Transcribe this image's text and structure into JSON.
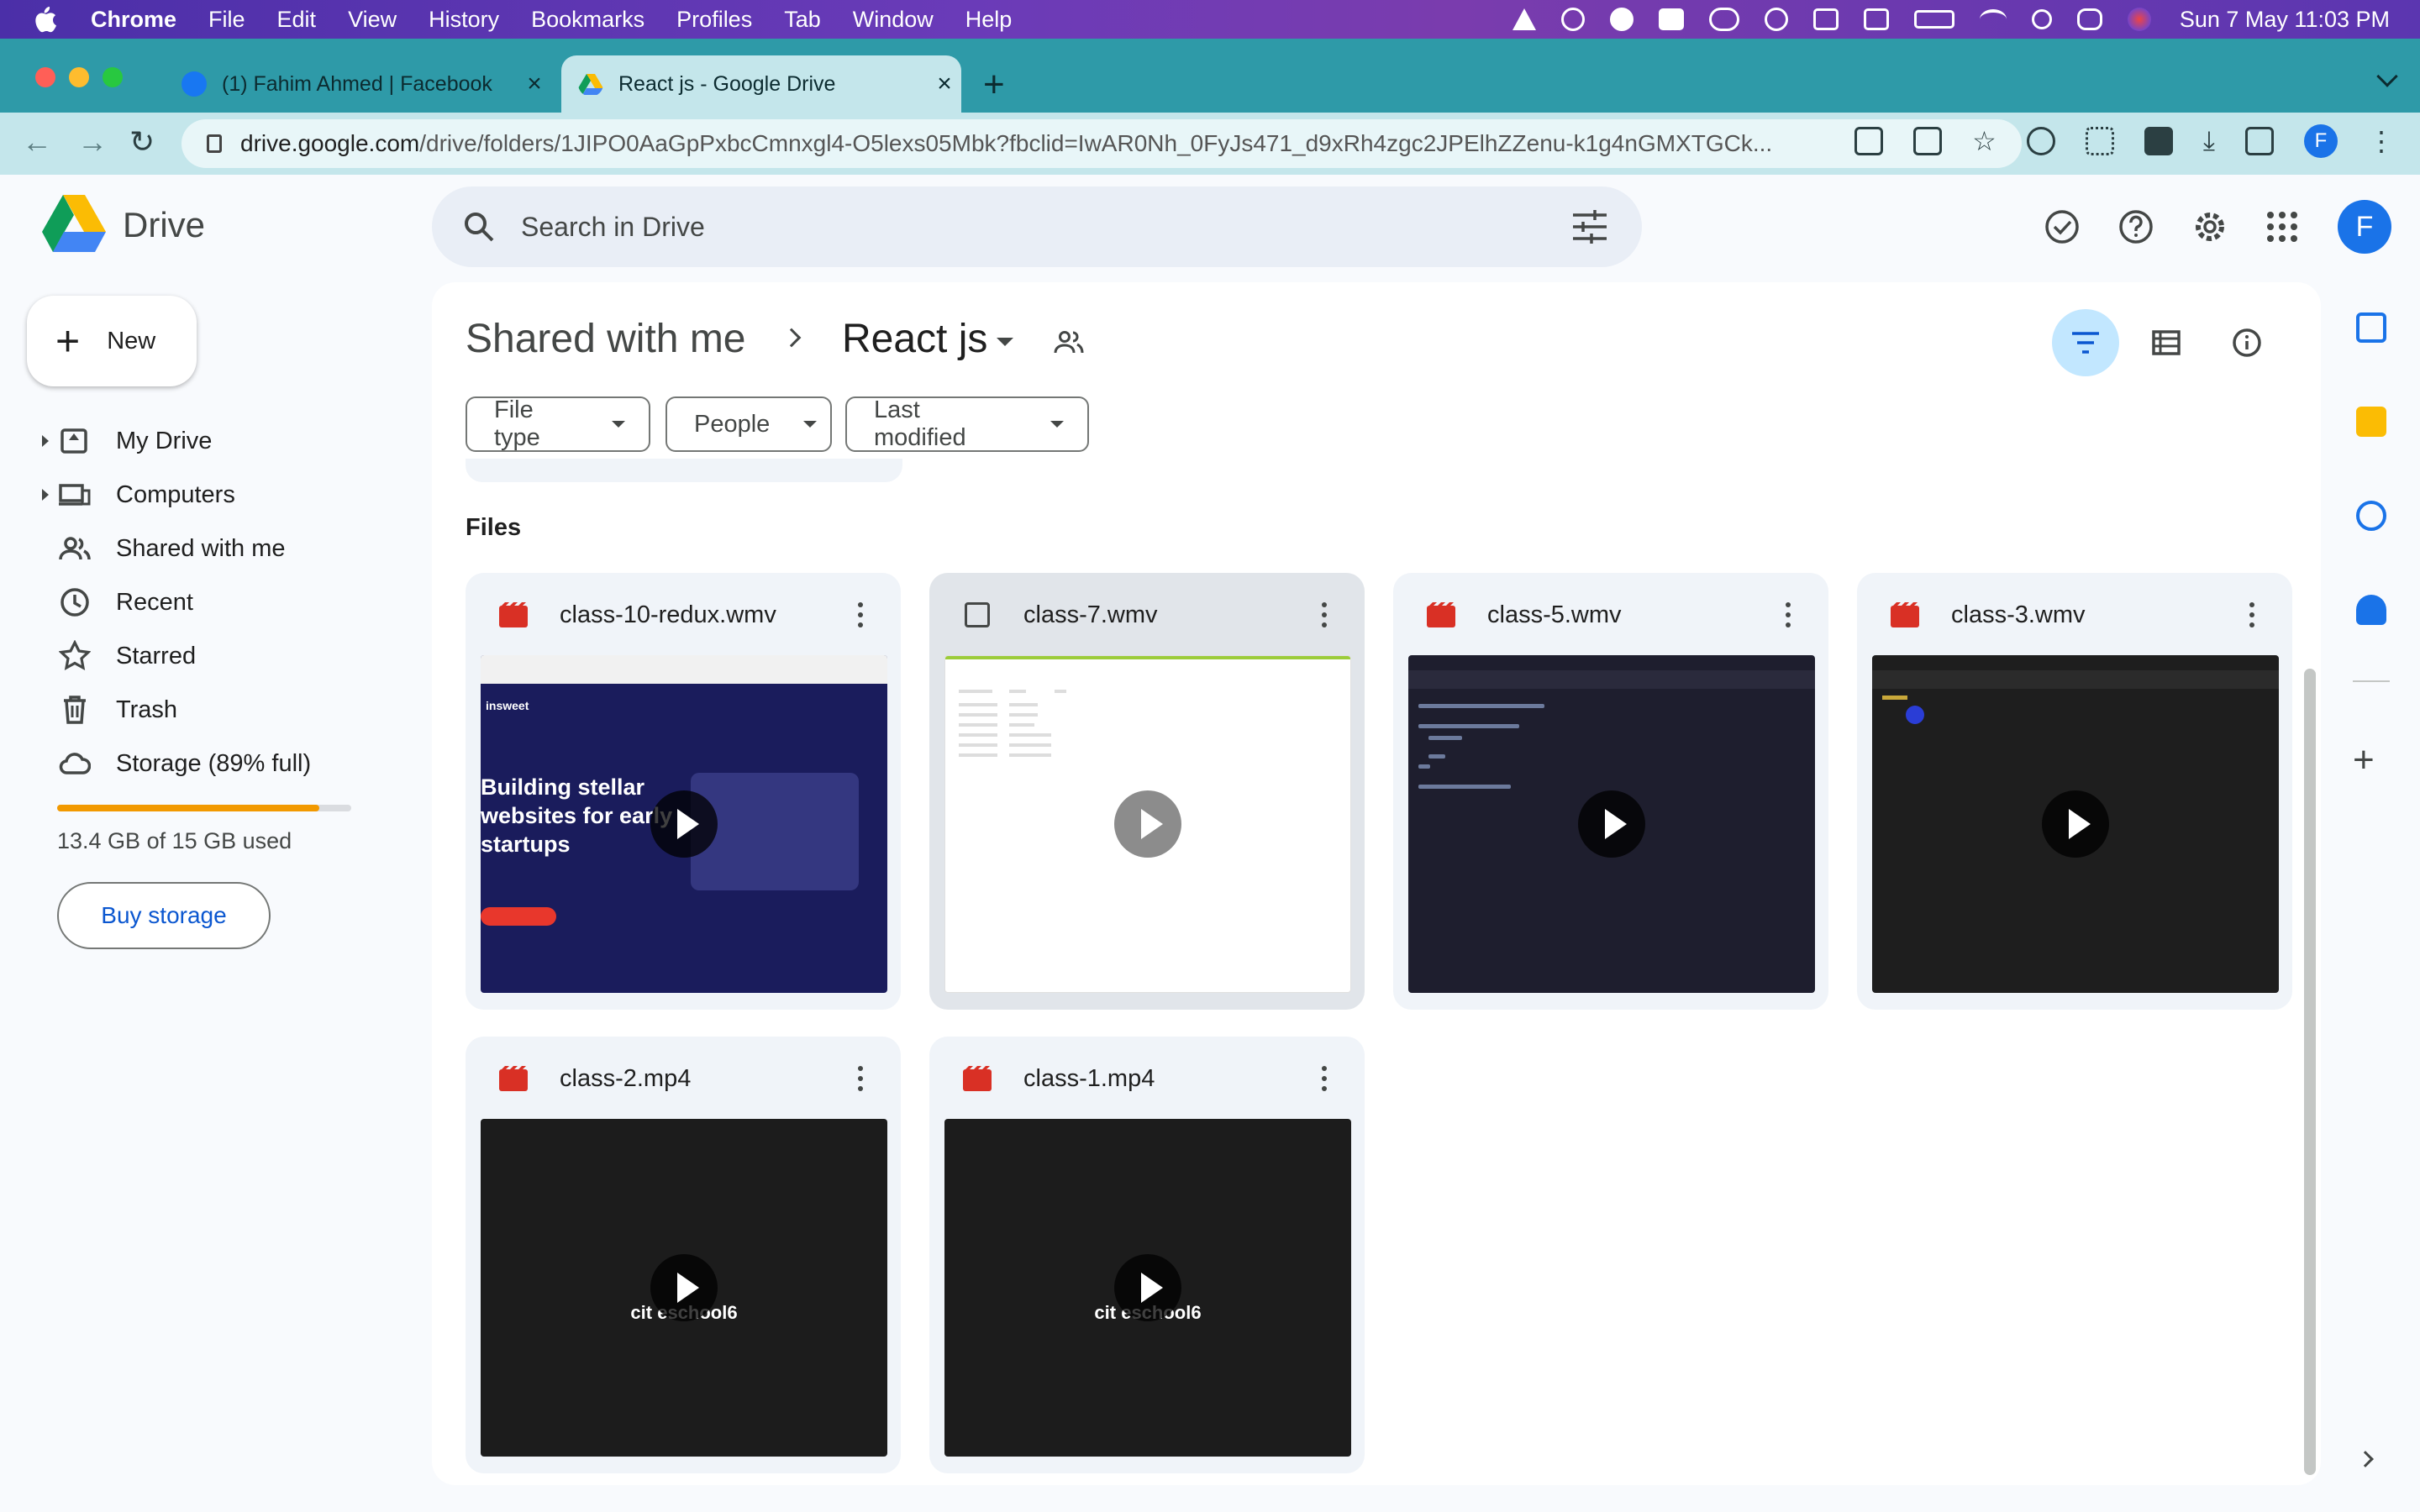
{
  "mac_menu": {
    "app": "Chrome",
    "items": [
      "File",
      "Edit",
      "View",
      "History",
      "Bookmarks",
      "Profiles",
      "Tab",
      "Window",
      "Help"
    ],
    "clock": "Sun 7 May  11:03 PM"
  },
  "tabs": [
    {
      "title": "(1) Fahim Ahmed | Facebook",
      "active": false
    },
    {
      "title": "React js - Google Drive",
      "active": true
    }
  ],
  "address": {
    "host": "drive.google.com",
    "path": "/drive/folders/1JIPO0AaGpPxbcCmnxgl4-O5lexs05Mbk?fbclid=IwAR0Nh_0FyJs471_d9xRh4zgc2JPElhZZenu-k1g4nGMXTGCk..."
  },
  "drive": {
    "app_name": "Drive",
    "search_placeholder": "Search in Drive",
    "avatar_letter": "F"
  },
  "sidebar": {
    "new_label": "New",
    "items": [
      {
        "label": "My Drive",
        "icon": "my-drive-icon",
        "expandable": true
      },
      {
        "label": "Computers",
        "icon": "computers-icon",
        "expandable": true
      },
      {
        "label": "Shared with me",
        "icon": "shared-with-me-icon",
        "expandable": false
      },
      {
        "label": "Recent",
        "icon": "clock-icon",
        "expandable": false
      },
      {
        "label": "Starred",
        "icon": "star-icon",
        "expandable": false
      },
      {
        "label": "Trash",
        "icon": "trash-icon",
        "expandable": false
      },
      {
        "label": "Storage (89% full)",
        "icon": "cloud-icon",
        "expandable": false
      }
    ],
    "storage_used_text": "13.4 GB of 15 GB used",
    "storage_fraction": 0.89,
    "buy_storage_label": "Buy storage"
  },
  "breadcrumb": {
    "parent": "Shared with me",
    "current": "React js"
  },
  "filters": [
    "File type",
    "People",
    "Last modified"
  ],
  "files_section_title": "Files",
  "files": [
    {
      "name": "class-10-redux.wmv",
      "thumb": "web"
    },
    {
      "name": "class-7.wmv",
      "thumb": "doc",
      "selected": true
    },
    {
      "name": "class-5.wmv",
      "thumb": "code"
    },
    {
      "name": "class-3.wmv",
      "thumb": "dark"
    },
    {
      "name": "class-2.mp4",
      "thumb": "black"
    },
    {
      "name": "class-1.mp4",
      "thumb": "black"
    }
  ],
  "thumb_text": {
    "web_brand": "insweet",
    "web_hero": "Building stellar websites for early startups",
    "watermark": "cit eschool6"
  },
  "colors": {
    "accent": "#1a73e8",
    "storage": "#f29900",
    "video_icon": "#d93025",
    "active_view": "#c2e7ff"
  }
}
